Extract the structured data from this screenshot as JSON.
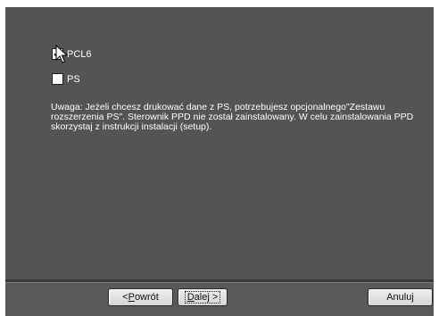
{
  "options": [
    {
      "label": "PCL6",
      "checked": true
    },
    {
      "label": "PS",
      "checked": false
    }
  ],
  "note": "Uwaga: Jeżeli chcesz drukować dane z PS, potrzebujesz opcjonalnego\"Zestawu rozszerzenia PS\". Sterownik PPD nie został zainstalowany. W celu zainstalowania PPD skorzystaj z instrukcji instalacji (setup).",
  "buttons": {
    "back": {
      "prefix": "< ",
      "mnemonic": "P",
      "rest": "owrót"
    },
    "next": {
      "mnemonic": "D",
      "rest": "alej >"
    },
    "cancel": "Anuluj"
  },
  "colors": {
    "dialog_bg": "#545454",
    "footer_bg": "#595959",
    "text": "#ffffff"
  }
}
